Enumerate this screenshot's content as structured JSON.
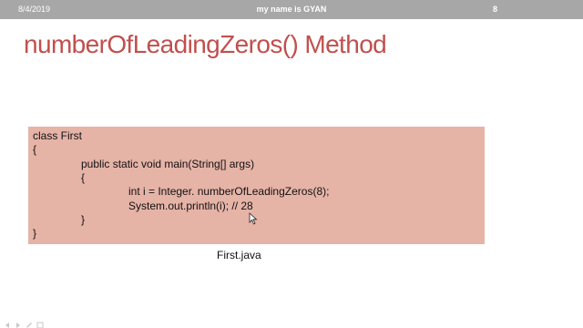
{
  "header": {
    "date": "8/4/2019",
    "footer_text": "my name is GYAN",
    "page_number": "8"
  },
  "slide": {
    "title": "numberOfLeadingZeros() Method",
    "code_lines": [
      "class First",
      "{",
      "public static void main(String[] args)",
      "{",
      "int i = Integer. numberOfLeadingZeros(8);",
      "System.out.println(i); // 28",
      "}",
      "}"
    ],
    "caption": "First.java"
  },
  "colors": {
    "title": "#c0504d",
    "code_background": "#e6b3a7",
    "header_bar": "#a7a7a7"
  },
  "icons": {
    "nav_controls": [
      "previous-slide-icon",
      "next-slide-icon",
      "pen-icon",
      "slide-menu-icon"
    ],
    "pointer": "mouse-pointer-icon"
  }
}
